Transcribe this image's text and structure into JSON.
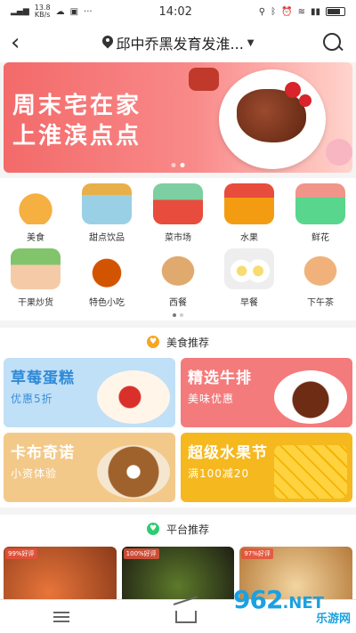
{
  "status_bar": {
    "speed_value": "13.8",
    "speed_unit": "KB/s",
    "time": "14:02"
  },
  "nav": {
    "location": "邱中乔黑发育发淮..."
  },
  "banner": {
    "line1": "周末宅在家",
    "line2": "上淮滨点点"
  },
  "categories_row1": [
    {
      "label": "美食",
      "icon": "noodle-bowl-icon",
      "color": "#f5b041"
    },
    {
      "label": "甜点饮品",
      "icon": "dessert-shop-icon",
      "color": "#9ad0e6"
    },
    {
      "label": "菜市场",
      "icon": "vegetable-basket-icon",
      "color": "#e74c3c"
    },
    {
      "label": "水果",
      "icon": "fruit-box-icon",
      "color": "#f39c12"
    },
    {
      "label": "鲜花",
      "icon": "flower-shop-icon",
      "color": "#58d68d"
    }
  ],
  "categories_row2": [
    {
      "label": "干果炒货",
      "icon": "nut-shop-icon",
      "color": "#82c46c"
    },
    {
      "label": "特色小吃",
      "icon": "snack-plate-icon",
      "color": "#d35400"
    },
    {
      "label": "西餐",
      "icon": "bread-icon",
      "color": "#e0a96d"
    },
    {
      "label": "早餐",
      "icon": "breakfast-egg-icon",
      "color": "#f7dc6f"
    },
    {
      "label": "下午茶",
      "icon": "pizza-icon",
      "color": "#f0b27a"
    }
  ],
  "food_section": {
    "title": "美食推荐",
    "promos": [
      {
        "title": "草莓蛋糕",
        "sub": "优惠5折",
        "bg": "#bfe0f7",
        "title_color": "#2f8ad8",
        "sub_color": "#3d8ed8"
      },
      {
        "title": "精选牛排",
        "sub": "美味优惠",
        "bg": "#f47b7b",
        "title_color": "#ffffff",
        "sub_color": "#ffffff"
      },
      {
        "title": "卡布奇诺",
        "sub": "小资体验",
        "bg": "#f3c98a",
        "title_color": "#ffffff",
        "sub_color": "#ffffff"
      },
      {
        "title": "超级水果节",
        "sub": "满100减20",
        "bg": "#f6b81f",
        "title_color": "#ffffff",
        "sub_color": "#ffffff"
      }
    ]
  },
  "platform_section": {
    "title": "平台推荐",
    "cards": [
      {
        "badge": "99%好评",
        "bg": "#c9683a"
      },
      {
        "badge": "100%好评",
        "bg": "#3b3f2a"
      },
      {
        "badge": "97%好评",
        "bg": "#d9a45e"
      }
    ]
  },
  "watermark": {
    "num": "962",
    "net": ".NET",
    "cn": "乐游网"
  }
}
